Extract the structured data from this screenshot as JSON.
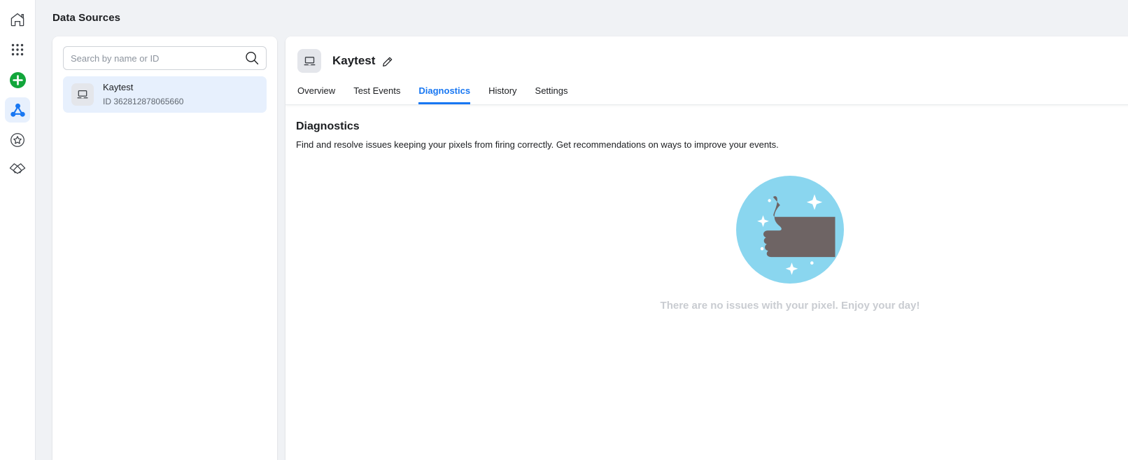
{
  "rail": {
    "items": [
      {
        "name": "home-icon",
        "label": "Home",
        "selected": false
      },
      {
        "name": "grid-apps-icon",
        "label": "All Tools",
        "selected": false
      },
      {
        "name": "plus-circle-icon",
        "label": "Create",
        "selected": false
      },
      {
        "name": "data-sources-icon",
        "label": "Data Sources",
        "selected": true
      },
      {
        "name": "star-circle-icon",
        "label": "Favorites",
        "selected": false
      },
      {
        "name": "handshake-icon",
        "label": "Partnerships",
        "selected": false
      }
    ]
  },
  "page": {
    "title": "Data Sources"
  },
  "search": {
    "placeholder": "Search by name or ID",
    "value": "",
    "icon": "search-icon"
  },
  "data_sources": [
    {
      "name": "Kaytest",
      "id_label": "ID",
      "id_value": "362812878065660",
      "icon": "laptop-icon",
      "selected": true
    }
  ],
  "source_header": {
    "icon": "laptop-icon",
    "name": "Kaytest",
    "edit_icon": "pencil-edit-icon"
  },
  "tabs": [
    {
      "label": "Overview",
      "active": false
    },
    {
      "label": "Test Events",
      "active": false
    },
    {
      "label": "Diagnostics",
      "active": true
    },
    {
      "label": "History",
      "active": false
    },
    {
      "label": "Settings",
      "active": false
    }
  ],
  "diagnostics": {
    "title": "Diagnostics",
    "description": "Find and resolve issues keeping your pixels from firing correctly. Get recommendations on ways to improve your events.",
    "empty_state": {
      "illustration": "thumbs-up-illustration",
      "message": "There are no issues with your pixel. Enjoy your day!"
    }
  },
  "colors": {
    "accent_blue": "#1877f2",
    "selected_row_bg": "#e7f0fd",
    "page_bg": "#f0f2f5",
    "illustration_circle": "#8ad6ef",
    "illustration_hand": "#6e6464",
    "empty_text": "#c9ccd1",
    "green_plus": "#12a63b"
  }
}
